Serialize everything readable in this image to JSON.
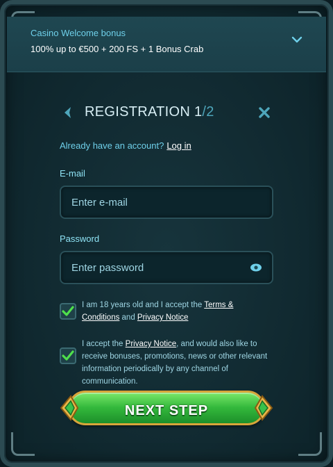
{
  "bonus": {
    "title": "Casino Welcome bonus",
    "description": "100% up to €500 + 200 FS + 1 Bonus Crab"
  },
  "header": {
    "title": "REGISTRATION 1",
    "step_total": "/2"
  },
  "login_prompt": {
    "text": "Already have an account?",
    "link": "Log in"
  },
  "form": {
    "email_label": "E-mail",
    "email_placeholder": "Enter e-mail",
    "password_label": "Password",
    "password_placeholder": "Enter password"
  },
  "consents": [
    {
      "checked": true,
      "pre": "I am 18 years old and I accept the ",
      "link1": "Terms & Conditions",
      "mid": " and ",
      "link2": "Privacy Notice"
    },
    {
      "checked": true,
      "pre": "I accept the ",
      "link1": "Privacy Notice",
      "post": ", and would also like to receive bonuses, promotions, news or other relevant information periodically by any channel of communication."
    }
  ],
  "cta": {
    "label": "NEXT STEP"
  },
  "icons": [
    "chevron-down-icon",
    "back-arrow-icon",
    "close-icon",
    "eye-icon",
    "checkmark-icon"
  ],
  "colors": {
    "accent": "#6fd0ea",
    "button_green": "#34b93c",
    "button_border": "#d8a53a",
    "panel": "#112a31"
  }
}
